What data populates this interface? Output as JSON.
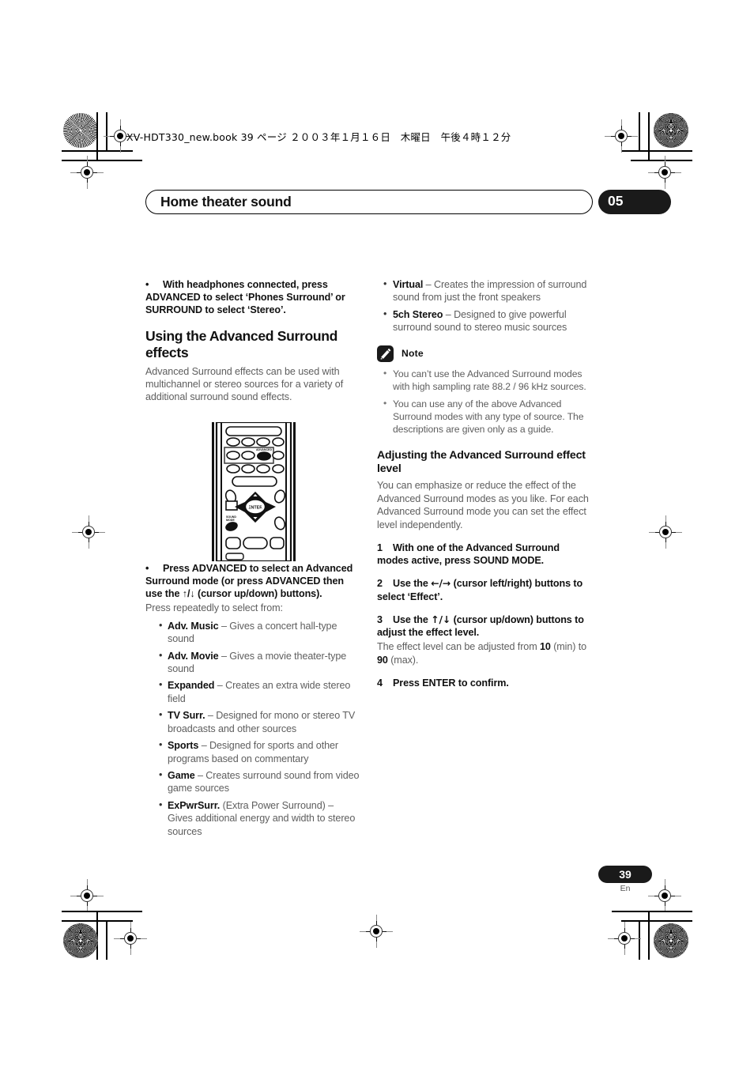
{
  "print_marks": {
    "slug": "XV-HDT330_new.book  39 ページ  ２００３年１月１６日　木曜日　午後４時１２分"
  },
  "header": {
    "running_title": "Home theater sound",
    "chapter_number": "05"
  },
  "left_column": {
    "headphones_bullet": {
      "bullet": "•",
      "text": "With headphones connected, press ADVANCED to select ‘Phones Surround’ or SURROUND to select ‘Stereo’."
    },
    "heading": "Using the Advanced Surround effects",
    "intro": "Advanced Surround effects can be used with multichannel or stereo sources for a variety of additional surround sound effects.",
    "remote_figure": {
      "name": "remote-control-illustration",
      "highlighted_button": "ADVANCED",
      "center_button": "ENTER",
      "sound_mode_button": "SOUND MODE"
    },
    "advanced_bullet": {
      "bullet": "•",
      "text": "Press ADVANCED to select an Advanced Surround mode (or press ADVANCED then use the ↑/↓ (cursor up/down) buttons)."
    },
    "press_repeatedly": "Press repeatedly to select from:",
    "modes": [
      {
        "name": "Adv. Music",
        "desc": " – Gives a concert hall-type sound"
      },
      {
        "name": "Adv. Movie",
        "desc": " – Gives a movie theater-type sound"
      },
      {
        "name": "Expanded",
        "desc": " – Creates an extra wide stereo field"
      },
      {
        "name": "TV Surr.",
        "desc": " – Designed for mono or stereo TV broadcasts and other sources"
      },
      {
        "name": "Sports",
        "desc": " – Designed for sports and other programs based on commentary"
      },
      {
        "name": "Game",
        "desc": " – Creates surround sound from video game sources"
      },
      {
        "name": "ExPwrSurr.",
        "desc": " (Extra Power Surround) – Gives additional energy and width to stereo sources"
      }
    ]
  },
  "right_column": {
    "modes": [
      {
        "name": "Virtual",
        "desc": " – Creates the impression of surround sound from just the front speakers"
      },
      {
        "name": "5ch Stereo",
        "desc": " – Designed to give powerful surround sound to stereo music sources"
      }
    ],
    "note": {
      "label": "Note",
      "icon": "pencil-icon",
      "items": [
        "You can’t use the Advanced Surround modes with high sampling rate 88.2 / 96 kHz sources.",
        "You can use any of the above Advanced Surround modes with any type of source. The descriptions are given only as a guide."
      ]
    },
    "adjust_section": {
      "heading": "Adjusting the Advanced Surround effect level",
      "intro": "You can emphasize or reduce the effect of the Advanced Surround modes as you like. For each Advanced Surround mode you can set the effect level independently.",
      "steps": [
        {
          "num": "1",
          "text": "With one of the Advanced Surround modes active, press SOUND MODE."
        },
        {
          "num": "2",
          "text_pre": "Use the ",
          "arrows": "←/→",
          "text_post": " (cursor left/right) buttons to select ‘Effect’."
        },
        {
          "num": "3",
          "text_pre": "Use the ",
          "arrows": "↑/↓",
          "text_post": " (cursor up/down) buttons to adjust the effect level."
        },
        {
          "num": "4",
          "text": "Press ENTER to confirm."
        }
      ],
      "step3_body_pre": "The effect level can be adjusted from ",
      "step3_min": "10",
      "step3_mid": " (min) to ",
      "step3_max": "90",
      "step3_post": " (max)."
    }
  },
  "footer": {
    "page_number": "39",
    "language": "En"
  },
  "colors": {
    "ink_black": "#1a1a1a",
    "body_gray": "#5e5e5e",
    "paper": "#ffffff"
  }
}
